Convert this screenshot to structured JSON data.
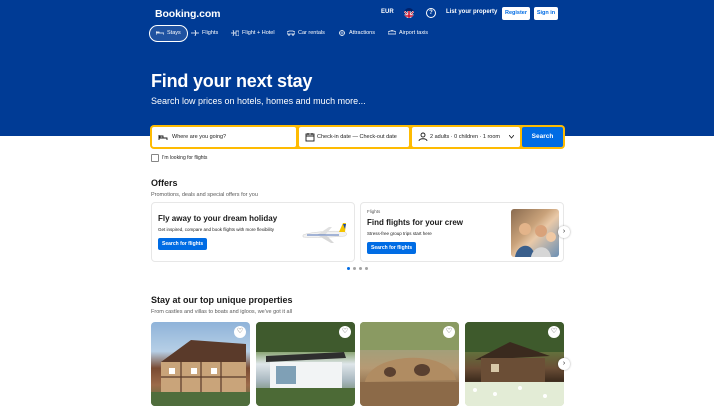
{
  "header": {
    "logo": "Booking.com",
    "currency": "EUR",
    "list_property": "List your property",
    "register": "Register",
    "sign_in": "Sign in",
    "help_icon": "question-icon",
    "flag_icon": "uk-flag-icon"
  },
  "nav": [
    {
      "label": "Stays",
      "icon": "bed-icon",
      "active": true
    },
    {
      "label": "Flights",
      "icon": "plane-icon"
    },
    {
      "label": "Flight + Hotel",
      "icon": "plane-hotel-icon"
    },
    {
      "label": "Car rentals",
      "icon": "car-icon"
    },
    {
      "label": "Attractions",
      "icon": "attractions-icon"
    },
    {
      "label": "Airport taxis",
      "icon": "taxi-icon"
    }
  ],
  "hero": {
    "title": "Find your next stay",
    "subtitle": "Search low prices on hotels, homes and much more..."
  },
  "search": {
    "destination_placeholder": "Where are you going?",
    "dates": "Check-in date — Check-out date",
    "guests": "2 adults · 0 children · 1 room",
    "button": "Search",
    "flights_checkbox": "I'm looking for flights"
  },
  "offers": {
    "title": "Offers",
    "subtitle": "Promotions, deals and special offers for you",
    "cards": [
      {
        "title": "Fly away to your dream holiday",
        "desc": "Get inspired, compare and book flights with more flexibility",
        "button": "Search for flights"
      },
      {
        "eyebrow": "Flights",
        "title": "Find flights for your crew",
        "desc": "Stress-free group trips start here",
        "button": "Search for flights"
      }
    ],
    "carousel_page": 1,
    "carousel_pages": 4
  },
  "unique": {
    "title": "Stay at our top unique properties",
    "subtitle": "From castles and villas to boats and igloos, we've got it all"
  },
  "colors": {
    "brand_blue": "#003b95",
    "accent_yellow": "#febb02",
    "button_blue": "#006ce4"
  }
}
